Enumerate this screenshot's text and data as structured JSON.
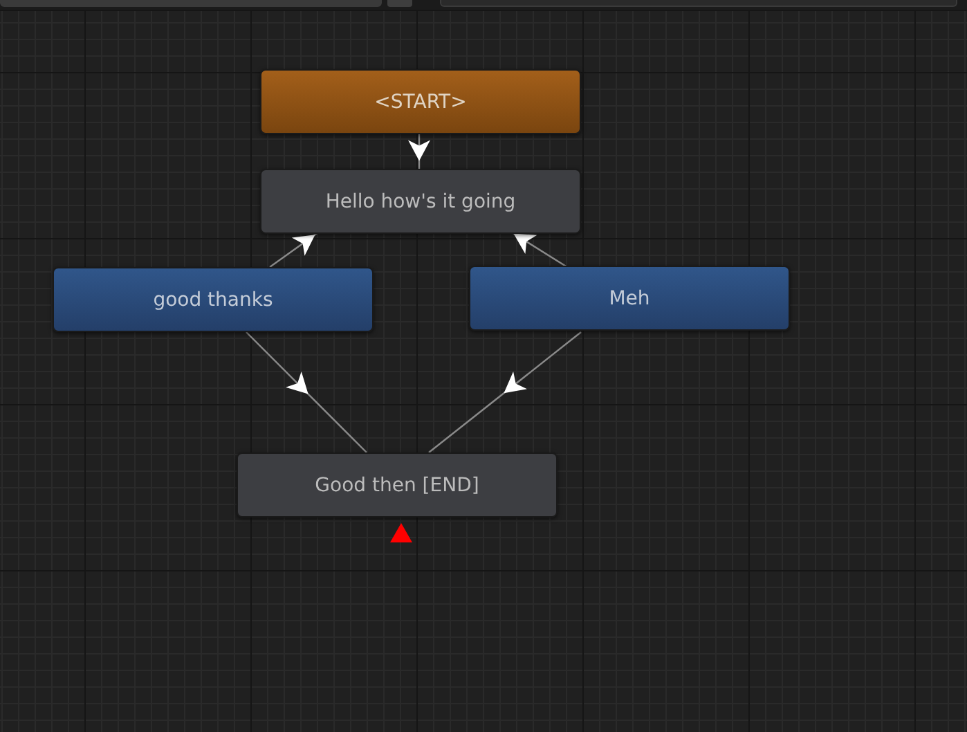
{
  "nodes": [
    {
      "kind": "start",
      "text": "<START>",
      "marked": false
    },
    {
      "kind": "dialogue",
      "text": "Hello how's it going",
      "marked": false
    },
    {
      "kind": "response",
      "text": "good thanks",
      "marked": false
    },
    {
      "kind": "response",
      "text": "Meh",
      "marked": false
    },
    {
      "kind": "dialogue",
      "text": "Good then [END]",
      "marked": true
    }
  ]
}
